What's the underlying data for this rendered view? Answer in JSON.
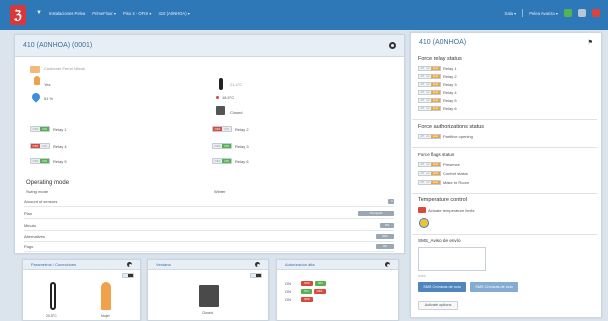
{
  "topbar": {
    "crumbs": [
      "Instalaciones Pelea",
      "PrimeFloor ▾",
      "Piso 4 - OFIS ▾",
      "410 (A0NHOA) ▾"
    ],
    "right": [
      "Sala ▾",
      "Pelea Avanza ▾"
    ]
  },
  "main_panel": {
    "title": "410 (A0NHOA) (0001)",
    "customer_note": "Customer Ferrol Nfowk",
    "person_label": "Yes",
    "humidity": "51 %",
    "temperature": "21.4°C",
    "temp_small": "18.5°C",
    "door_label": "Closed",
    "relays": [
      {
        "label": "Relay 1",
        "state": "ON"
      },
      {
        "label": "Relay 2",
        "state": "OFF"
      },
      {
        "label": "Relay 4",
        "state": "OFF"
      },
      {
        "label": "Relay 3",
        "state": "ON"
      },
      {
        "label": "Relay 5",
        "state": "ON"
      },
      {
        "label": "Relay 6",
        "state": "ON"
      }
    ],
    "operating_mode_title": "Operating mode",
    "operating_mode_label": "Swing mode",
    "operating_mode_value": "Winter",
    "list_rows": [
      {
        "label": "Amount of sensors",
        "value": "3"
      },
      {
        "label": "Plan",
        "value": "Occupied"
      },
      {
        "label": "Minuto",
        "value": "ON"
      },
      {
        "label": "Alternatives",
        "value": "OFF"
      },
      {
        "label": "Pago",
        "value": "OK"
      }
    ]
  },
  "right_panel": {
    "title": "410 (A0NHOA)",
    "force_relay_title": "Force relay status",
    "force_relays": [
      "Relay 1",
      "Relay 2",
      "Relay 3",
      "Relay 4",
      "Relay 5",
      "Relay 6"
    ],
    "force_auth_title": "Force authorizations status",
    "force_auth_items": [
      "Partitive opening"
    ],
    "force_flags_title": "Force flags status",
    "force_flags": [
      "Presence",
      "Confort status",
      "Make to Room"
    ],
    "temp_control_title": "Temperature control",
    "temp_control_label": "Actuate temperature limits",
    "sms_title": "SMS_Aviso de envío",
    "send_btn": "SMS Crónicas de ocio",
    "send_btn2": "SMS Crónicas de ocio",
    "update_btn": "Activate options",
    "textarea_hint": "0/160"
  },
  "bottom_panels": [
    {
      "title": "Parametros / Conexiones",
      "caption1": "20.5°C",
      "caption2": "Mujer"
    },
    {
      "title": "Ventana",
      "caption1": "Closed"
    },
    {
      "title": "Autorizacion alta",
      "rows": [
        {
          "label": "ON",
          "a": "OFF",
          "b": "ON"
        },
        {
          "label": "ON",
          "a": "ON",
          "b": "OFF"
        },
        {
          "label": "ON",
          "a": "OFF",
          "b": ""
        }
      ]
    }
  ]
}
